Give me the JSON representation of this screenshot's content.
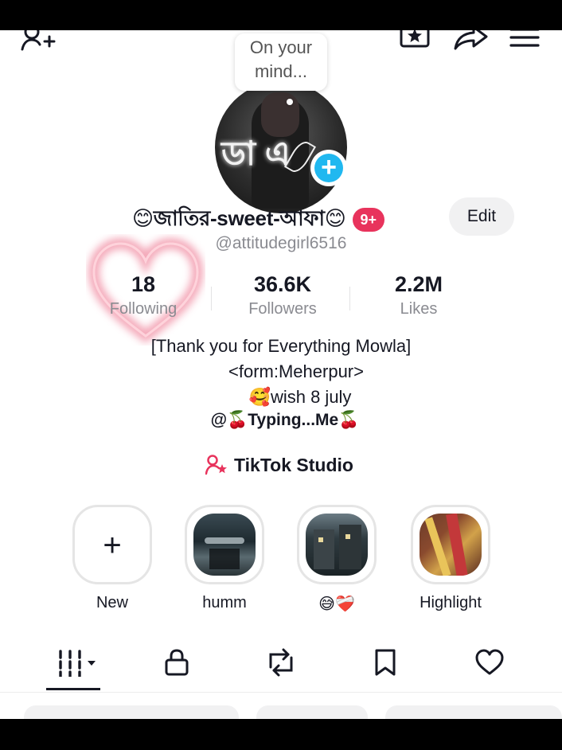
{
  "status_bubble": {
    "line1": "On your",
    "line2": "mind..."
  },
  "profile": {
    "display_name": "😊জাতির-sweet-আফা😊",
    "notification_badge": "9+",
    "edit_label": "Edit",
    "username": "@attitudegirl6516"
  },
  "stats": [
    {
      "value": "18",
      "label": "Following"
    },
    {
      "value": "36.6K",
      "label": "Followers"
    },
    {
      "value": "2.2M",
      "label": "Likes"
    }
  ],
  "bio": {
    "line1": "[Thank you for Everything Mowla]",
    "line2": "<form:Meherpur>",
    "line3": "🥰wish 8 july",
    "line4": "@🍒Typing...Me🍒"
  },
  "studio": {
    "label": "TikTok Studio"
  },
  "highlights": [
    {
      "label": "New"
    },
    {
      "label": "humm"
    },
    {
      "label": "😅❤️‍🩹"
    },
    {
      "label": "Highlight"
    }
  ],
  "tabs": [
    {
      "icon": "videos-grid-icon",
      "active": true
    },
    {
      "icon": "lock-icon",
      "active": false
    },
    {
      "icon": "repost-icon",
      "active": false
    },
    {
      "icon": "bookmark-icon",
      "active": false
    },
    {
      "icon": "heart-icon",
      "active": false
    }
  ],
  "colors": {
    "badge": "#e8335c",
    "add_story": "#20b8f0",
    "muted_text": "#8a8b91",
    "heart_glow": "#f08aa0",
    "studio_icon": "#e8335c"
  }
}
